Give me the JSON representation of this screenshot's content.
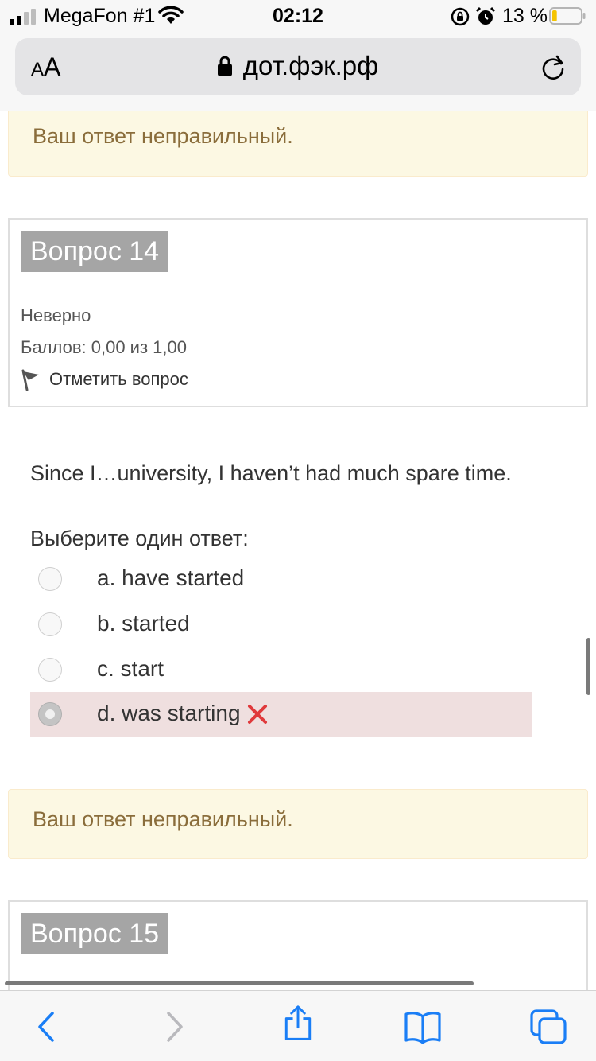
{
  "status_bar": {
    "carrier": "MegaFon #1",
    "time": "02:12",
    "battery_percent": "13 %",
    "battery_level": 0.13,
    "icons": [
      "signal-icon",
      "wifi-icon",
      "orientation-lock-icon",
      "alarm-icon",
      "battery-icon"
    ]
  },
  "browser": {
    "text_size_label_small": "A",
    "text_size_label_large": "A",
    "url": "дот.фэк.рф",
    "icons": [
      "lock-icon",
      "reload-icon"
    ]
  },
  "feedback_top": {
    "text": "Ваш ответ неправильный."
  },
  "question14": {
    "title": "Вопрос 14",
    "state": "Неверно",
    "grade": "Баллов: 0,00 из 1,00",
    "flag_label": "Отметить вопрос",
    "text": "Since I…university, I haven’t had much spare time.",
    "prompt": "Выберите один ответ:",
    "answers": [
      {
        "label": "a. have started",
        "selected": false
      },
      {
        "label": "b. started",
        "selected": false
      },
      {
        "label": "c. start",
        "selected": false
      },
      {
        "label": "d. was starting",
        "selected": true,
        "incorrect": true
      }
    ]
  },
  "feedback_bottom": {
    "text": "Ваш ответ неправильный."
  },
  "question15": {
    "title": "Вопрос 15"
  },
  "toolbar": {
    "icons": [
      "back-icon",
      "forward-icon",
      "share-icon",
      "bookmarks-icon",
      "tabs-icon"
    ]
  },
  "colors": {
    "feedback_bg": "#fcf8e3",
    "feedback_text": "#8a6d3b",
    "question_badge": "#a5a5a5",
    "incorrect_bg": "#efdfdf",
    "cross": "#e0393b",
    "ios_blue": "#1a7ef6"
  }
}
